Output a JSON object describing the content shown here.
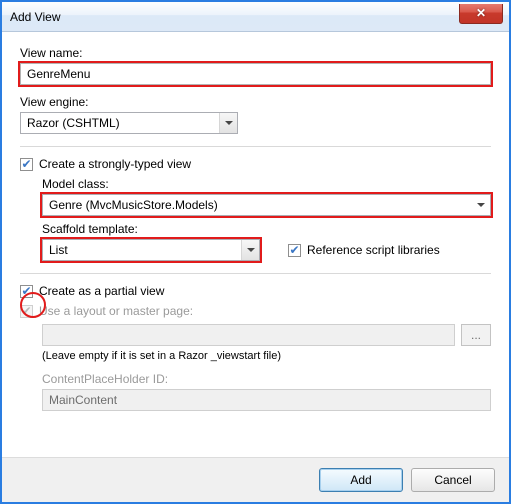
{
  "window": {
    "title": "Add View"
  },
  "viewName": {
    "label": "View name:",
    "value": "GenreMenu"
  },
  "viewEngine": {
    "label": "View engine:",
    "value": "Razor (CSHTML)"
  },
  "stronglyTyped": {
    "label": "Create a strongly-typed view",
    "checked": true
  },
  "modelClass": {
    "label": "Model class:",
    "value": "Genre (MvcMusicStore.Models)"
  },
  "scaffold": {
    "label": "Scaffold template:",
    "value": "List"
  },
  "refScripts": {
    "label": "Reference script libraries",
    "checked": true
  },
  "partial": {
    "label": "Create as a partial view",
    "checked": true
  },
  "useLayout": {
    "label": "Use a layout or master page:",
    "checked": true,
    "value": ""
  },
  "layoutHint": "(Leave empty if it is set in a Razor _viewstart file)",
  "placeholder": {
    "label": "ContentPlaceHolder ID:",
    "value": "MainContent"
  },
  "browse": "...",
  "buttons": {
    "ok": "Add",
    "cancel": "Cancel"
  },
  "glyph": {
    "close": "✕",
    "check": "✔"
  }
}
